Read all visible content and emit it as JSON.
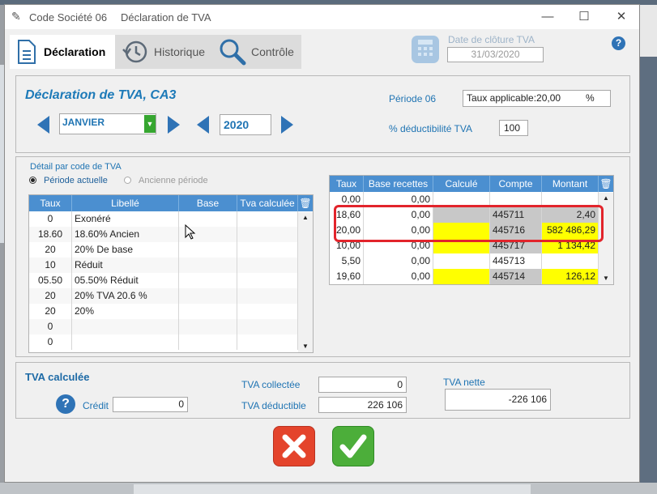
{
  "window": {
    "app_title": "Code Société 06",
    "doc_title": "Déclaration de TVA",
    "minimize": "—",
    "maximize": "☐",
    "close": "✕"
  },
  "tabs": [
    {
      "label": "Déclaration"
    },
    {
      "label": "Historique"
    },
    {
      "label": "Contrôle"
    }
  ],
  "closing": {
    "label": "Date de clôture TVA",
    "value": "31/03/2020"
  },
  "help_glyph": "?",
  "header": {
    "title": "Déclaration de TVA, CA3",
    "month": "JANVIER",
    "year": "2020",
    "periode_label": "Période 06",
    "taux_value": "Taux applicable:20,00",
    "percent": "%",
    "deduct_label": "% déductibilité TVA",
    "deduct_value": "100"
  },
  "detail": {
    "title": "Détail par code de TVA",
    "radio1": "Période actuelle",
    "radio2": "Ancienne période"
  },
  "left_table": {
    "headers": [
      "Taux",
      "Libellé",
      "Base",
      "Tva calculée"
    ],
    "rows": [
      [
        "0",
        "Exonéré"
      ],
      [
        "18.60",
        "18.60% Ancien"
      ],
      [
        "20",
        "20% De base"
      ],
      [
        "10",
        "Réduit"
      ],
      [
        "05.50",
        "05.50% Réduit"
      ],
      [
        "20",
        "20% TVA 20.6 %"
      ],
      [
        "20",
        "20%"
      ],
      [
        "0",
        ""
      ],
      [
        "0",
        ""
      ]
    ]
  },
  "right_table": {
    "headers": [
      "Taux",
      "Base recettes",
      "Calculé",
      "Compte",
      "Montant"
    ],
    "rows": [
      {
        "taux": "0,00",
        "base": "0,00",
        "calc": "",
        "compte": "",
        "montant": "",
        "calc_bg": "#ffffff",
        "compte_bg": "#ffffff",
        "montant_bg": "#ffffff"
      },
      {
        "taux": "18,60",
        "base": "0,00",
        "calc": "",
        "compte": "445711",
        "montant": "2,40",
        "calc_bg": "#c8c8c8",
        "compte_bg": "#c8c8c8",
        "montant_bg": "#c8c8c8"
      },
      {
        "taux": "20,00",
        "base": "0,00",
        "calc": "",
        "compte": "445716",
        "montant": "582 486,29",
        "calc_bg": "#ffff00",
        "compte_bg": "#c8c8c8",
        "montant_bg": "#ffff00"
      },
      {
        "taux": "10,00",
        "base": "0,00",
        "calc": "",
        "compte": "445717",
        "montant": "1 134,42",
        "calc_bg": "#ffff00",
        "compte_bg": "#c8c8c8",
        "montant_bg": "#ffff00"
      },
      {
        "taux": "5,50",
        "base": "0,00",
        "calc": "",
        "compte": "445713",
        "montant": "",
        "calc_bg": "#ffffff",
        "compte_bg": "#ffffff",
        "montant_bg": "#ffffff"
      },
      {
        "taux": "19,60",
        "base": "0,00",
        "calc": "",
        "compte": "445714",
        "montant": "126,12",
        "calc_bg": "#ffff00",
        "compte_bg": "#c8c8c8",
        "montant_bg": "#ffff00"
      }
    ]
  },
  "tva": {
    "title": "TVA calculée",
    "credit_label": "Crédit",
    "credit_value": "0",
    "collectee_label": "TVA collectée",
    "collectee_value": "0",
    "deductible_label": "TVA déductible",
    "deductible_value": "226 106",
    "nette_label": "TVA nette",
    "nette_value": "-226 106"
  },
  "colors": {
    "accent": "#1f74b3",
    "header": "#4b8fd0",
    "highlight": "#e2242b",
    "cancel": "#e4442c",
    "ok": "#4cae3a"
  }
}
